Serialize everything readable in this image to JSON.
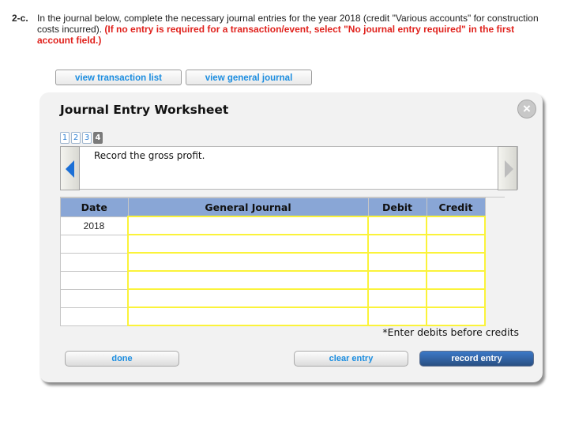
{
  "question": {
    "number": "2-c.",
    "text": "In the journal below, complete the necessary journal entries for the year 2018 (credit \"Various accounts\" for construction costs incurred). ",
    "instruction": "(If no entry is required for a transaction/event, select \"No journal entry required\" in the first account field.)"
  },
  "top_buttons": {
    "view_transaction_list": "view transaction list",
    "view_general_journal": "view general journal"
  },
  "worksheet": {
    "title": "Journal Entry Worksheet",
    "close_icon": "×",
    "pages": [
      "1",
      "2",
      "3",
      "4"
    ],
    "active_page": "4",
    "description": "Record the gross profit.",
    "table": {
      "headers": {
        "date": "Date",
        "general_journal": "General Journal",
        "debit": "Debit",
        "credit": "Credit"
      },
      "rows": [
        {
          "date": "2018",
          "account": "",
          "debit": "",
          "credit": ""
        },
        {
          "date": "",
          "account": "",
          "debit": "",
          "credit": ""
        },
        {
          "date": "",
          "account": "",
          "debit": "",
          "credit": ""
        },
        {
          "date": "",
          "account": "",
          "debit": "",
          "credit": ""
        },
        {
          "date": "",
          "account": "",
          "debit": "",
          "credit": ""
        },
        {
          "date": "",
          "account": "",
          "debit": "",
          "credit": ""
        }
      ]
    },
    "note": "*Enter debits before credits",
    "buttons": {
      "done": "done",
      "clear_entry": "clear entry",
      "record_entry": "record entry"
    }
  },
  "colors": {
    "instruction_red": "#e0211c",
    "link_blue": "#1b8de0",
    "header_blue": "#89a6d6",
    "input_border_yellow": "#fbf33a",
    "record_button_blue": "#2a4f82"
  }
}
